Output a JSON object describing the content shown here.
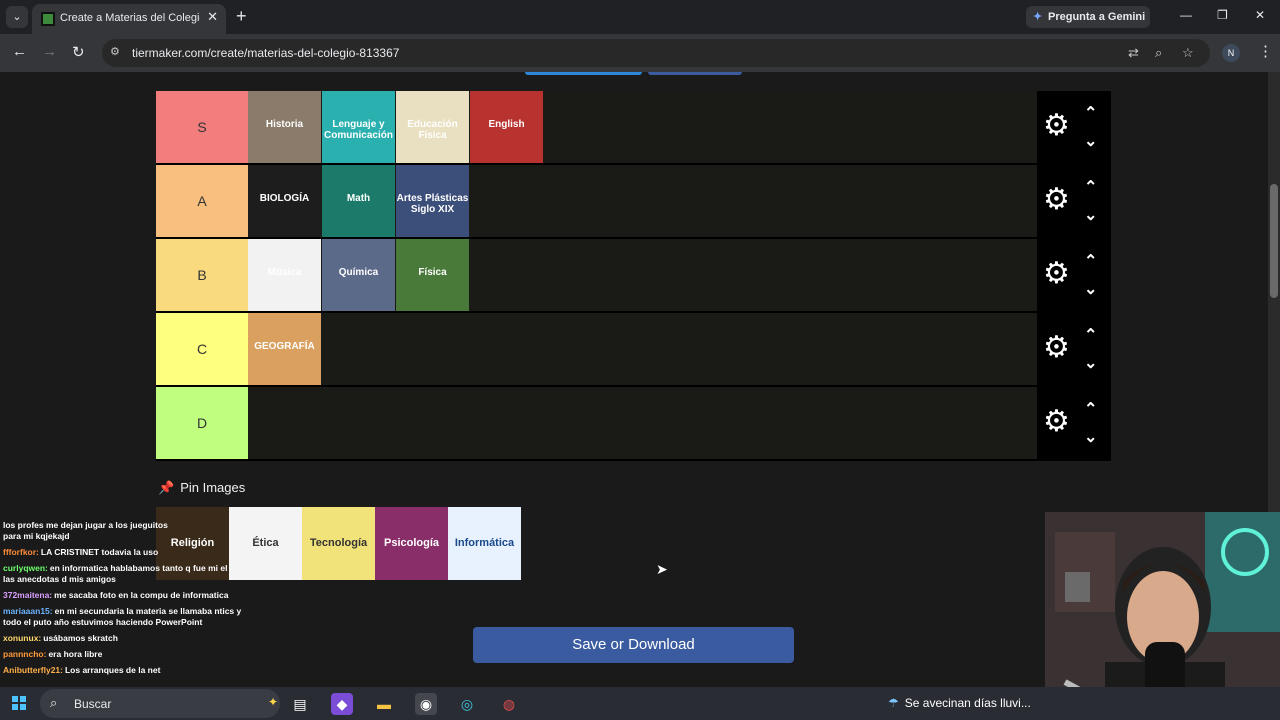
{
  "browser": {
    "tab_title": "Create a Materias del Colegio. T",
    "tab_close": "✕",
    "new_tab": "+",
    "gemini_label": "Pregunta a Gemini",
    "url": "tiermaker.com/create/materias-del-colegio-813367",
    "profile_initial": "N"
  },
  "tiers": [
    {
      "label": "S",
      "color": "#f27d7d",
      "items": [
        "Historia",
        "Lenguaje y Comunicación",
        "Educación Física",
        "English"
      ]
    },
    {
      "label": "A",
      "color": "#f8bf7e",
      "items": [
        "BIOLOGÍA",
        "Math",
        "Artes Plásticas Siglo XIX"
      ]
    },
    {
      "label": "B",
      "color": "#f9da7f",
      "items": [
        "Música",
        "Química",
        "Física"
      ]
    },
    {
      "label": "C",
      "color": "#fefe7f",
      "items": [
        "GEOGRAFÍA"
      ]
    },
    {
      "label": "D",
      "color": "#c0fe7f",
      "items": []
    }
  ],
  "pin": {
    "label": "Pin Images"
  },
  "pinned_items": [
    "Religión",
    "Ética",
    "Tecnología",
    "Psicología",
    "Informática"
  ],
  "save_label": "Save or Download",
  "chat": [
    {
      "user": "",
      "text": "los profes me dejan jugar a los jueguitos",
      "tail": "para mi kqjekajd",
      "color": "#ffffff"
    },
    {
      "user": "ffforfkor:",
      "text": "LA CRISTINET todavia la uso",
      "color": "#ff8c3a"
    },
    {
      "user": "curlyqwen:",
      "text": "en informatica hablabamos tanto q fue mi el",
      "tail": "las anecdotas d mis amigos",
      "color": "#6cff6c"
    },
    {
      "user": "372maitena:",
      "text": "me sacaba foto en la compu de informatica",
      "color": "#d9a0ff"
    },
    {
      "user": "mariaaan15:",
      "text": "en mi secundaria la materia se llamaba ntics y",
      "tail": "todo el puto año estuvimos haciendo PowerPoint",
      "color": "#6cb4ff"
    },
    {
      "user": "xonunux:",
      "text": "usábamos skratch",
      "color": "#ffd86c"
    },
    {
      "user": "pannncho:",
      "text": "era hora libre",
      "color": "#ff9a3a"
    },
    {
      "user": "Anibutterfly21:",
      "text": "Los arranques de la net",
      "color": "#ffb04a"
    }
  ],
  "taskbar": {
    "search_label": "Buscar",
    "weather": "Se avecinan días lluvi..."
  }
}
